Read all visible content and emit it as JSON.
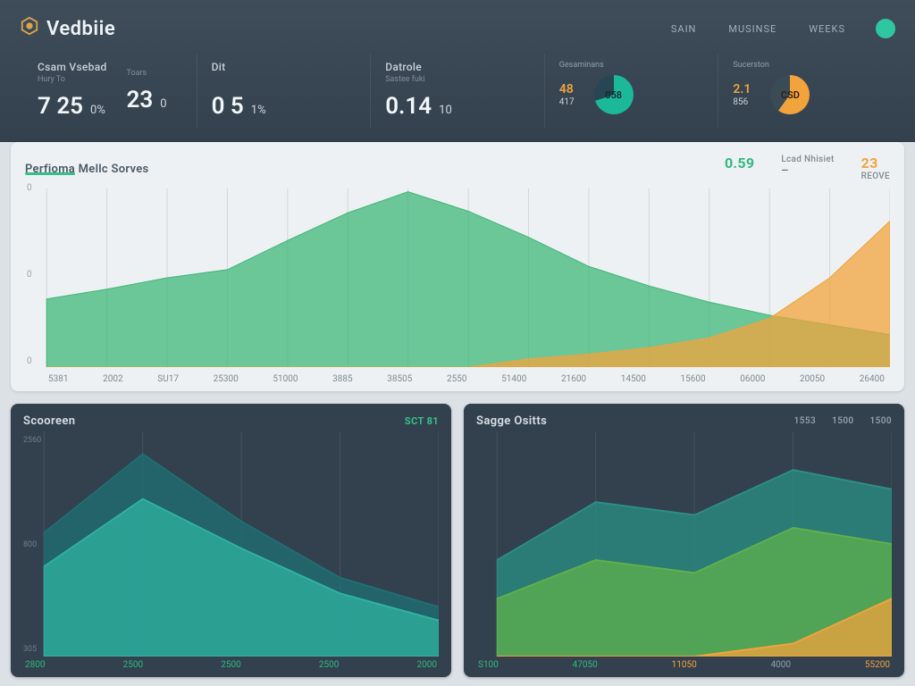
{
  "brand": "Vedbiie",
  "nav": {
    "item1": "SAIN",
    "item2": "MUSINSE",
    "item3": "WEEKS"
  },
  "metrics": {
    "c1": {
      "label": "Csam Vsebad",
      "sublabel": "Hury To",
      "value": "7 25",
      "suffix": "0%"
    },
    "c2": {
      "label": "",
      "sublabel": "Toars",
      "value": "23",
      "suffix": "0"
    },
    "c3": {
      "label": "Dit",
      "sublabel": "",
      "value": "0  5",
      "suffix": "1%"
    },
    "c4": {
      "label": "Datrole",
      "sublabel": "Sastee fuki",
      "value": "0.14",
      "suffix": "10"
    },
    "c5": {
      "label": "Gesaminans",
      "left_top": "48",
      "left_bot": "417",
      "donut": "058"
    },
    "c6": {
      "label": "Sucerston",
      "left_top": "2.1",
      "left_bot": "856",
      "donut": "CSD"
    }
  },
  "main_panel": {
    "title": "Perfioma Mellc Sorves",
    "kpi1_label": "",
    "kpi1_val": "0.59",
    "kpi2_label": "Lcad Nhisiet",
    "kpi2_sub": "—",
    "kpi3_val": "23",
    "kpi3_sub": "REOVE"
  },
  "bottom": {
    "left_title": "Scooreen",
    "left_badge": "SCT 81",
    "right_title": "Sagge Ositts"
  },
  "chart_data": [
    {
      "id": "main_area",
      "type": "area",
      "title": "Perfioma Mellc Sorves",
      "x": [
        "5381",
        "2002",
        "SU17",
        "25300",
        "51000",
        "3885",
        "38505",
        "2550",
        "51400",
        "21600",
        "14500",
        "15600",
        "06000",
        "20050",
        "26400"
      ],
      "series": [
        {
          "name": "green",
          "color": "#3fb779",
          "values": [
            42,
            48,
            55,
            60,
            78,
            95,
            108,
            96,
            80,
            62,
            50,
            40,
            32,
            26,
            20
          ]
        },
        {
          "name": "orange",
          "color": "#f2a33c",
          "values": [
            0,
            0,
            0,
            0,
            0,
            0,
            0,
            0,
            5,
            8,
            12,
            18,
            30,
            55,
            90
          ]
        }
      ],
      "ylim": [
        0,
        110
      ],
      "yticks": [
        "0",
        "0",
        "0"
      ]
    },
    {
      "id": "bottom_left",
      "type": "area",
      "title": "Scooreen",
      "x": [
        "2800",
        "2500",
        "2500",
        "2500",
        "2000"
      ],
      "series": [
        {
          "name": "teal-dark",
          "color": "#1f6f74",
          "values": [
            55,
            90,
            60,
            35,
            22
          ]
        },
        {
          "name": "teal-light",
          "color": "#2fb3a0",
          "values": [
            40,
            70,
            48,
            28,
            16
          ]
        }
      ],
      "ylim": [
        0,
        100
      ],
      "yticks": [
        "2560",
        "800",
        "305"
      ]
    },
    {
      "id": "bottom_right",
      "type": "area",
      "title": "Sagge Ositts",
      "x": [
        "S100",
        "47050",
        "11050",
        "4000",
        "55200"
      ],
      "series": [
        {
          "name": "teal",
          "color": "#2a8f86",
          "values": [
            30,
            48,
            44,
            58,
            52
          ]
        },
        {
          "name": "green",
          "color": "#5fb04b",
          "values": [
            18,
            30,
            26,
            40,
            35
          ]
        },
        {
          "name": "orange",
          "color": "#f2a33c",
          "values": [
            0,
            0,
            0,
            4,
            18
          ]
        }
      ],
      "ylim": [
        0,
        70
      ],
      "yticks": [
        "",
        "",
        ""
      ],
      "right_legend": [
        "1553",
        "1500",
        "1500"
      ]
    }
  ]
}
